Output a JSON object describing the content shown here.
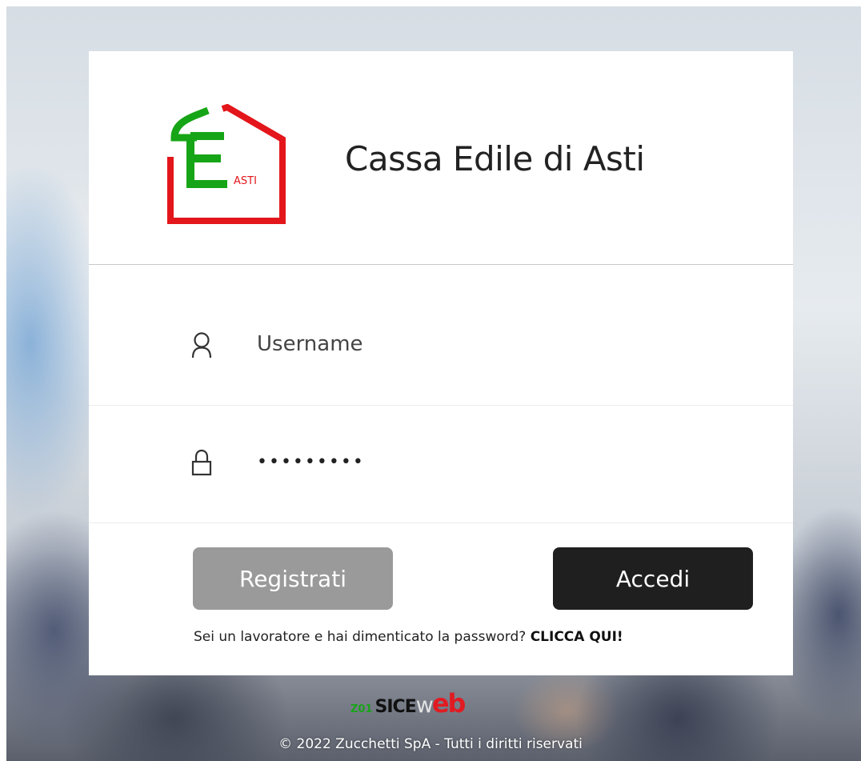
{
  "org": {
    "name": "Cassa Edile di Asti",
    "logo_text": "ASTI"
  },
  "form": {
    "username": {
      "placeholder": "Username",
      "value": ""
    },
    "password": {
      "value": "•••••••••"
    }
  },
  "buttons": {
    "register": "Registrati",
    "login": "Accedi"
  },
  "forgot": {
    "text": "Sei un lavoratore e hai dimenticato la password? ",
    "cta": "CLICCA QUI!"
  },
  "brand": {
    "code": "Z01",
    "part1": "SICE",
    "part2": "w",
    "part3": "eb"
  },
  "footer": {
    "copyright": "© 2022 Zucchetti SpA - Tutti i diritti riservati"
  },
  "icons": {
    "username": "user-icon",
    "password": "lock-icon"
  },
  "colors": {
    "logo_green": "#16a516",
    "logo_red": "#e3161b",
    "login_button": "#1f1f1f",
    "register_button": "#9a9a9a"
  }
}
